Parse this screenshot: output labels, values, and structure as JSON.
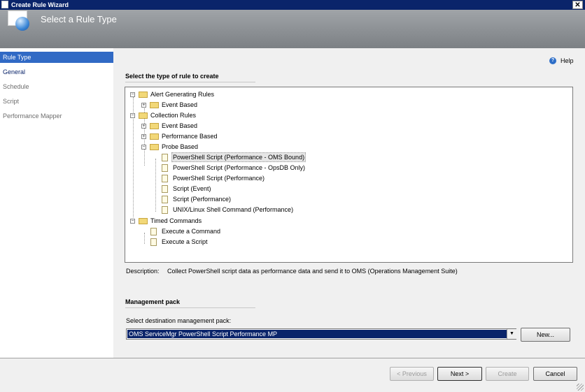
{
  "window": {
    "title": "Create Rule Wizard",
    "close_glyph": "✕"
  },
  "header": {
    "title": "Select a Rule Type"
  },
  "sidebar": {
    "items": [
      {
        "label": "Rule Type"
      },
      {
        "label": "General"
      },
      {
        "label": "Schedule"
      },
      {
        "label": "Script"
      },
      {
        "label": "Performance Mapper"
      }
    ]
  },
  "help": {
    "label": "Help",
    "icon": "help-icon"
  },
  "main": {
    "section_title": "Select the type of rule to create",
    "tree": {
      "alert_generating_rules": "Alert Generating Rules",
      "alert_event_based": "Event Based",
      "collection_rules": "Collection Rules",
      "collection_event_based": "Event Based",
      "performance_based": "Performance Based",
      "probe_based": "Probe Based",
      "ps_oms_bound": "PowerShell Script (Performance - OMS Bound)",
      "ps_opsdb_only": "PowerShell Script (Performance - OpsDB Only)",
      "ps_performance": "PowerShell Script (Performance)",
      "script_event": "Script (Event)",
      "script_performance": "Script (Performance)",
      "unix_shell": "UNIX/Linux Shell Command (Performance)",
      "timed_commands": "Timed Commands",
      "execute_command": "Execute a Command",
      "execute_script": "Execute a Script"
    },
    "description_label": "Description:",
    "description_text": "Collect PowerShell script data as performance data and send it to OMS (Operations Management Suite)"
  },
  "management_pack": {
    "section_title": "Management pack",
    "select_label": "Select destination management pack:",
    "selected_value": "OMS ServiceMgr PowerShell Script Performance MP",
    "new_button": "New..."
  },
  "footer": {
    "previous": "< Previous",
    "next": "Next >",
    "create": "Create",
    "cancel": "Cancel"
  }
}
